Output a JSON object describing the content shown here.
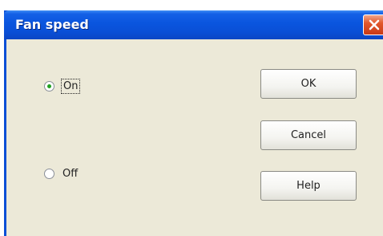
{
  "window": {
    "title": "Fan speed"
  },
  "radios": [
    {
      "label": "On",
      "selected": true
    },
    {
      "label": "Off",
      "selected": false
    }
  ],
  "buttons": {
    "ok": "OK",
    "cancel": "Cancel",
    "help": "Help"
  },
  "colors": {
    "titlebar": "#0a4fd6",
    "dialog_bg": "#ece9d8",
    "close_button": "#e2582c",
    "radio_dot": "#21a121"
  }
}
